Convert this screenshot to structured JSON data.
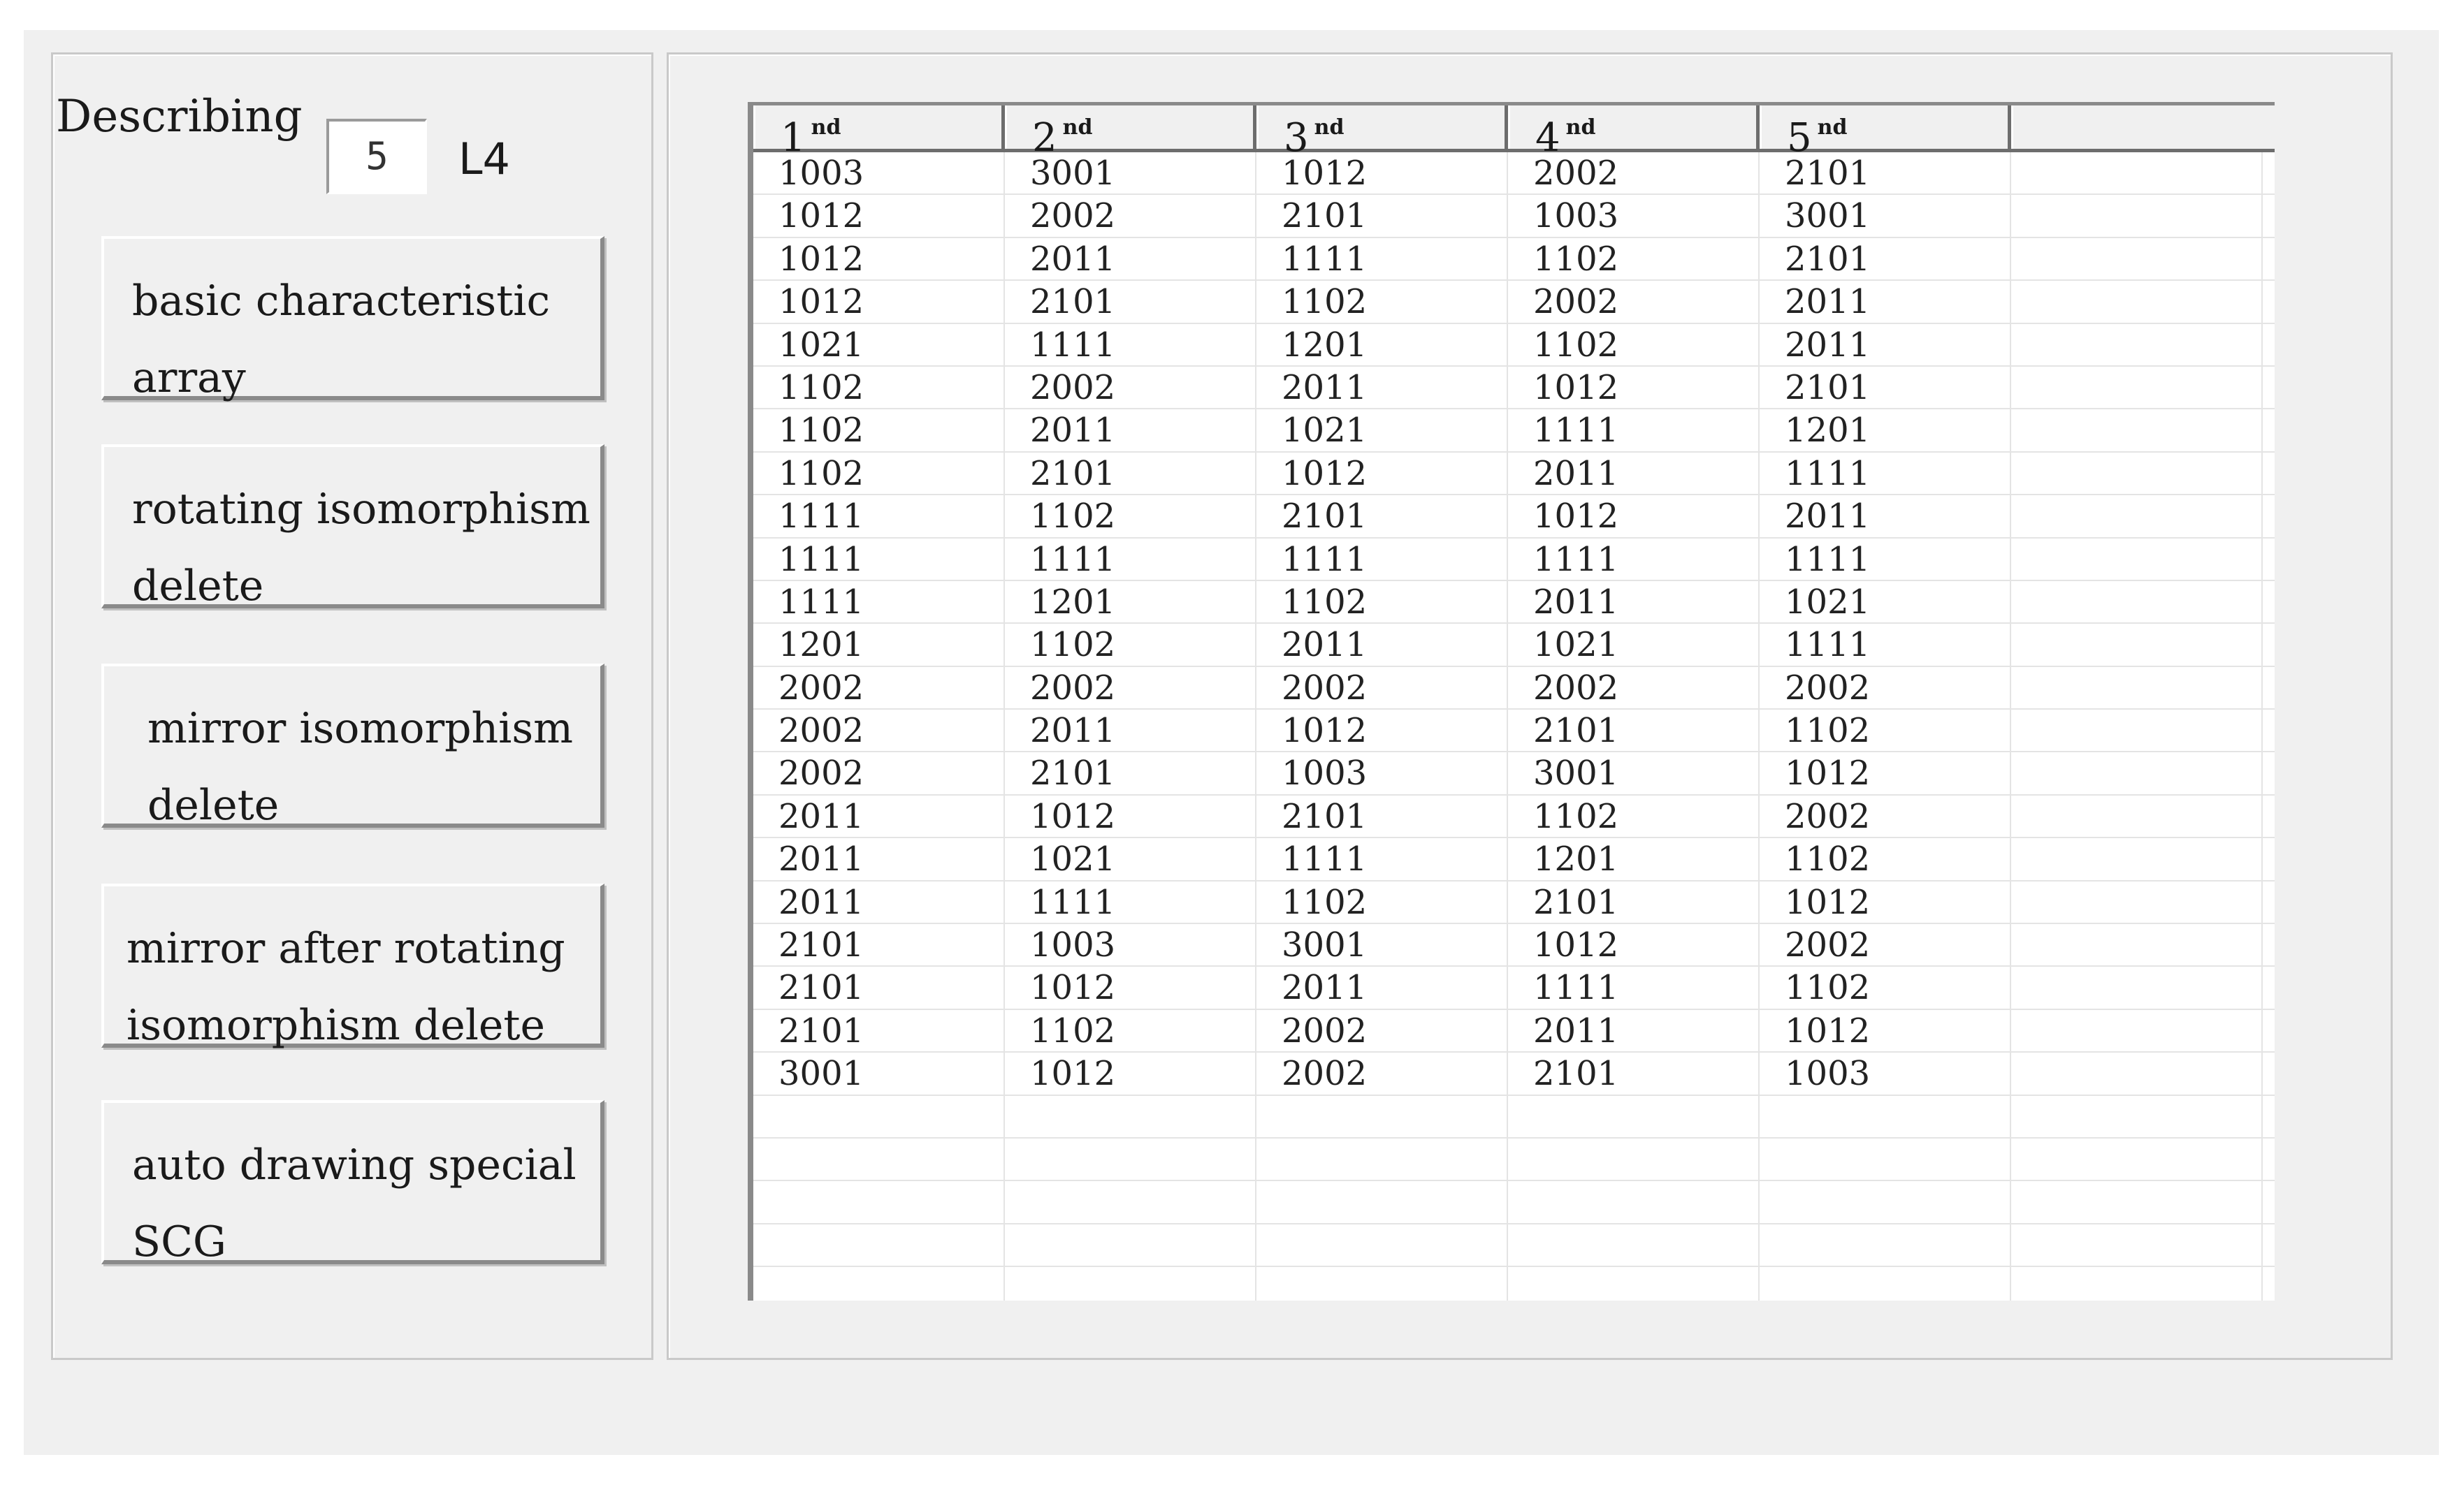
{
  "left_panel": {
    "describing_label": "Describing",
    "describing_value": "5",
    "unit_label": "L4",
    "buttons": [
      "basic characteristic\narray",
      "rotating isomorphism\ndelete",
      "mirror isomorphism\ndelete",
      "mirror after rotating\nisomorphism delete",
      "auto drawing special\nSCG"
    ]
  },
  "table": {
    "columns": [
      {
        "main": "1",
        "sup": "nd"
      },
      {
        "main": "2",
        "sup": "nd"
      },
      {
        "main": "3",
        "sup": "nd"
      },
      {
        "main": "4",
        "sup": "nd"
      },
      {
        "main": "5",
        "sup": "nd"
      }
    ],
    "rows": [
      [
        "1003",
        "3001",
        "1012",
        "2002",
        "2101"
      ],
      [
        "1012",
        "2002",
        "2101",
        "1003",
        "3001"
      ],
      [
        "1012",
        "2011",
        "1111",
        "1102",
        "2101"
      ],
      [
        "1012",
        "2101",
        "1102",
        "2002",
        "2011"
      ],
      [
        "1021",
        "1111",
        "1201",
        "1102",
        "2011"
      ],
      [
        "1102",
        "2002",
        "2011",
        "1012",
        "2101"
      ],
      [
        "1102",
        "2011",
        "1021",
        "1111",
        "1201"
      ],
      [
        "1102",
        "2101",
        "1012",
        "2011",
        "1111"
      ],
      [
        "1111",
        "1102",
        "2101",
        "1012",
        "2011"
      ],
      [
        "1111",
        "1111",
        "1111",
        "1111",
        "1111"
      ],
      [
        "1111",
        "1201",
        "1102",
        "2011",
        "1021"
      ],
      [
        "1201",
        "1102",
        "2011",
        "1021",
        "1111"
      ],
      [
        "2002",
        "2002",
        "2002",
        "2002",
        "2002"
      ],
      [
        "2002",
        "2011",
        "1012",
        "2101",
        "1102"
      ],
      [
        "2002",
        "2101",
        "1003",
        "3001",
        "1012"
      ],
      [
        "2011",
        "1012",
        "2101",
        "1102",
        "2002"
      ],
      [
        "2011",
        "1021",
        "1111",
        "1201",
        "1102"
      ],
      [
        "2011",
        "1111",
        "1102",
        "2101",
        "1012"
      ],
      [
        "2101",
        "1003",
        "3001",
        "1012",
        "2002"
      ],
      [
        "2101",
        "1012",
        "2011",
        "1111",
        "1102"
      ],
      [
        "2101",
        "1102",
        "2002",
        "2011",
        "1012"
      ],
      [
        "3001",
        "1012",
        "2002",
        "2101",
        "1003"
      ]
    ],
    "empty_rows": 5
  }
}
